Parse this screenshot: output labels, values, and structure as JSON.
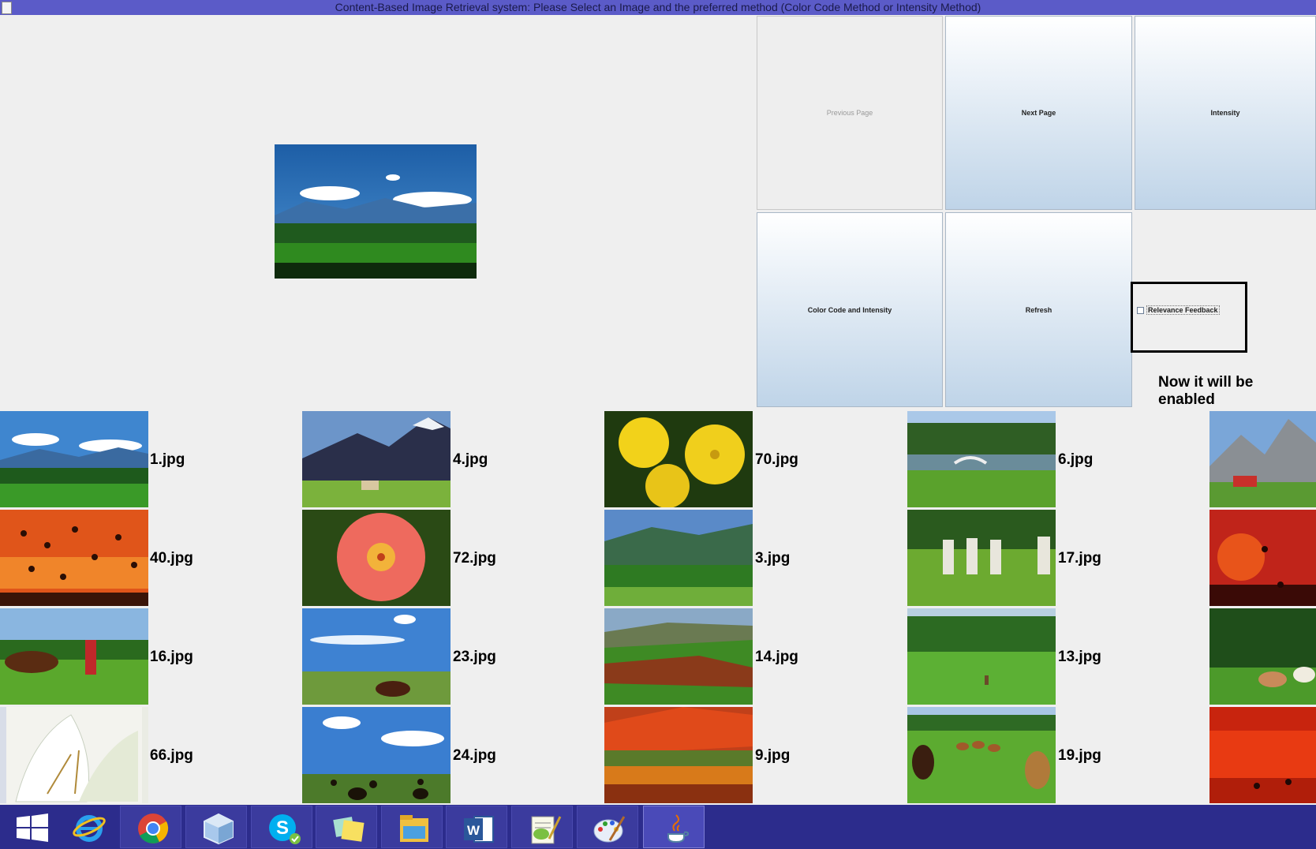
{
  "window": {
    "title": "Content-Based Image Retrieval system: Please Select an Image and the preferred method (Color Code Method or Intensity Method)"
  },
  "buttons": {
    "previous_page": "Previous Page",
    "next_page": "Next Page",
    "intensity": "Intensity",
    "color_code_and_intensity": "Color Code and Intensity",
    "refresh": "Refresh"
  },
  "relevance_feedback": {
    "label": "Relevance Feedback",
    "checked": false
  },
  "annotation": {
    "text": "Now it will be enabled"
  },
  "results": [
    {
      "name": "1.jpg",
      "icon": "mountain-landscape"
    },
    {
      "name": "4.jpg",
      "icon": "snow-mountain-valley"
    },
    {
      "name": "70.jpg",
      "icon": "yellow-flowers"
    },
    {
      "name": "6.jpg",
      "icon": "garden-bridge"
    },
    {
      "name": "",
      "icon": "alpine-house"
    },
    {
      "name": "40.jpg",
      "icon": "birds-sunset"
    },
    {
      "name": "72.jpg",
      "icon": "red-flower"
    },
    {
      "name": "3.jpg",
      "icon": "tropical-hills"
    },
    {
      "name": "17.jpg",
      "icon": "stone-monuments"
    },
    {
      "name": "",
      "icon": "sunset-birds"
    },
    {
      "name": "16.jpg",
      "icon": "cowboy-horse"
    },
    {
      "name": "23.jpg",
      "icon": "rider-prairie"
    },
    {
      "name": "14.jpg",
      "icon": "green-hills"
    },
    {
      "name": "13.jpg",
      "icon": "meadow-trees"
    },
    {
      "name": "",
      "icon": "horses-forest"
    },
    {
      "name": "66.jpg",
      "icon": "white-lily"
    },
    {
      "name": "24.jpg",
      "icon": "cattle-herd"
    },
    {
      "name": "9.jpg",
      "icon": "autumn-fields"
    },
    {
      "name": "19.jpg",
      "icon": "cattle-riders"
    },
    {
      "name": "",
      "icon": "orange-sunset"
    }
  ],
  "taskbar": [
    {
      "icon": "windows-start-icon"
    },
    {
      "icon": "internet-explorer-icon"
    },
    {
      "icon": "chrome-icon"
    },
    {
      "icon": "virtualbox-icon"
    },
    {
      "icon": "skype-icon"
    },
    {
      "icon": "sticky-notes-icon"
    },
    {
      "icon": "file-explorer-icon"
    },
    {
      "icon": "word-icon"
    },
    {
      "icon": "notepad-plus-plus-icon"
    },
    {
      "icon": "paint-icon"
    },
    {
      "icon": "java-icon"
    }
  ]
}
